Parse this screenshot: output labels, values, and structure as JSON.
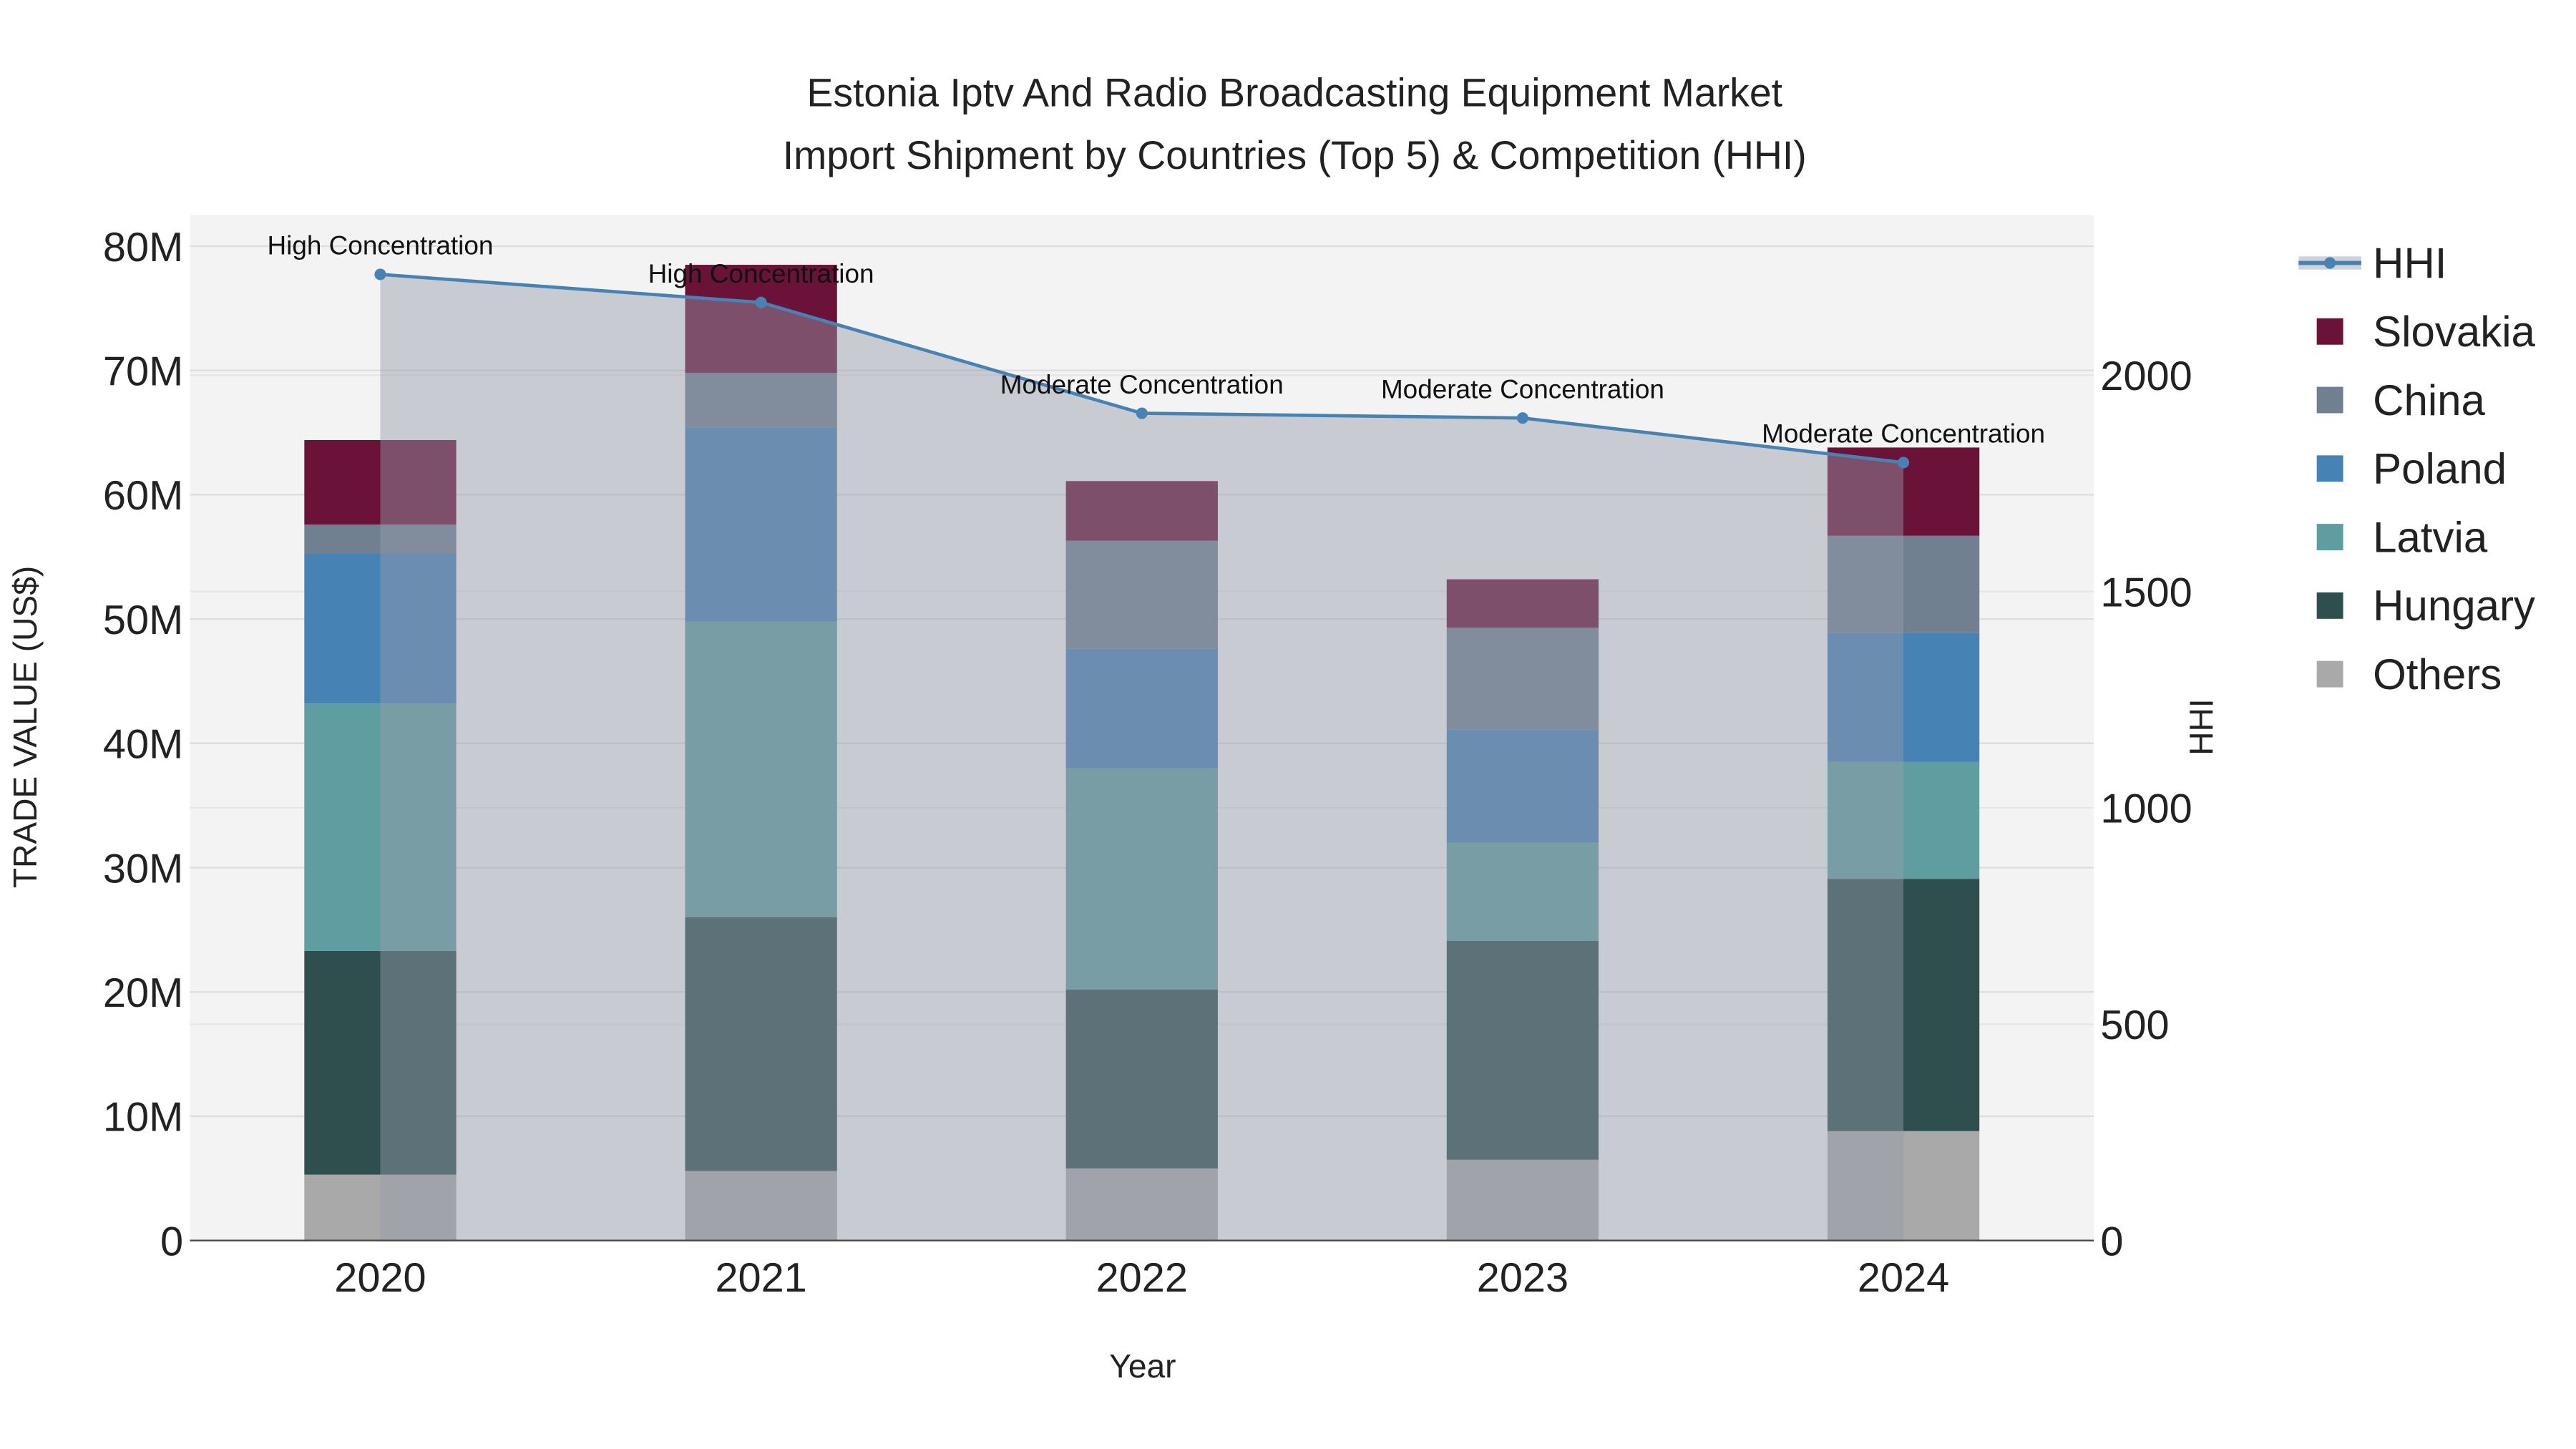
{
  "chart_data": {
    "type": "bar",
    "stacked": true,
    "title": [
      "Estonia Iptv And Radio Broadcasting Equipment Market",
      "Import Shipment by Countries (Top 5) & Competition (HHI)"
    ],
    "xlabel": "Year",
    "ylabel": "TRADE VALUE (US$)",
    "y2label": "HHI",
    "categories": [
      "2020",
      "2021",
      "2022",
      "2023",
      "2024"
    ],
    "ylim": [
      0,
      82500000
    ],
    "y2lim": [
      0,
      2370
    ],
    "yticks": [
      {
        "v": 0,
        "label": "0"
      },
      {
        "v": 10000000,
        "label": "10M"
      },
      {
        "v": 20000000,
        "label": "20M"
      },
      {
        "v": 30000000,
        "label": "30M"
      },
      {
        "v": 40000000,
        "label": "40M"
      },
      {
        "v": 50000000,
        "label": "50M"
      },
      {
        "v": 60000000,
        "label": "60M"
      },
      {
        "v": 70000000,
        "label": "70M"
      },
      {
        "v": 80000000,
        "label": "80M"
      }
    ],
    "y2ticks": [
      {
        "v": 0,
        "label": "0"
      },
      {
        "v": 500,
        "label": "500"
      },
      {
        "v": 1000,
        "label": "1000"
      },
      {
        "v": 1500,
        "label": "1500"
      },
      {
        "v": 2000,
        "label": "2000"
      }
    ],
    "series": [
      {
        "name": "Others",
        "color": "#a9a9a9",
        "values": [
          5300000,
          5600000,
          5800000,
          6500000,
          8800000
        ]
      },
      {
        "name": "Hungary",
        "color": "#2f4f4f",
        "values": [
          18000000,
          20400000,
          14400000,
          17600000,
          20300000
        ]
      },
      {
        "name": "Latvia",
        "color": "#5f9ea0",
        "values": [
          19900000,
          23800000,
          17800000,
          7900000,
          9400000
        ]
      },
      {
        "name": "Poland",
        "color": "#4682b4",
        "values": [
          12100000,
          15600000,
          9600000,
          9100000,
          10400000
        ]
      },
      {
        "name": "China",
        "color": "#708090",
        "values": [
          2300000,
          4400000,
          8700000,
          8200000,
          7800000
        ]
      },
      {
        "name": "Slovakia",
        "color": "#6b1238",
        "values": [
          6800000,
          8700000,
          4800000,
          3900000,
          7100000
        ]
      }
    ],
    "hhi": {
      "name": "HHI",
      "color": "#4682b4",
      "values": [
        2233,
        2168,
        1912,
        1901,
        1798
      ],
      "annotations": [
        "High Concentration",
        "High Concentration",
        "Moderate Concentration",
        "Moderate Concentration",
        "Moderate Concentration"
      ]
    },
    "legend": [
      "HHI",
      "Slovakia",
      "China",
      "Poland",
      "Latvia",
      "Hungary",
      "Others"
    ],
    "legend_position": "right",
    "grid": true
  }
}
